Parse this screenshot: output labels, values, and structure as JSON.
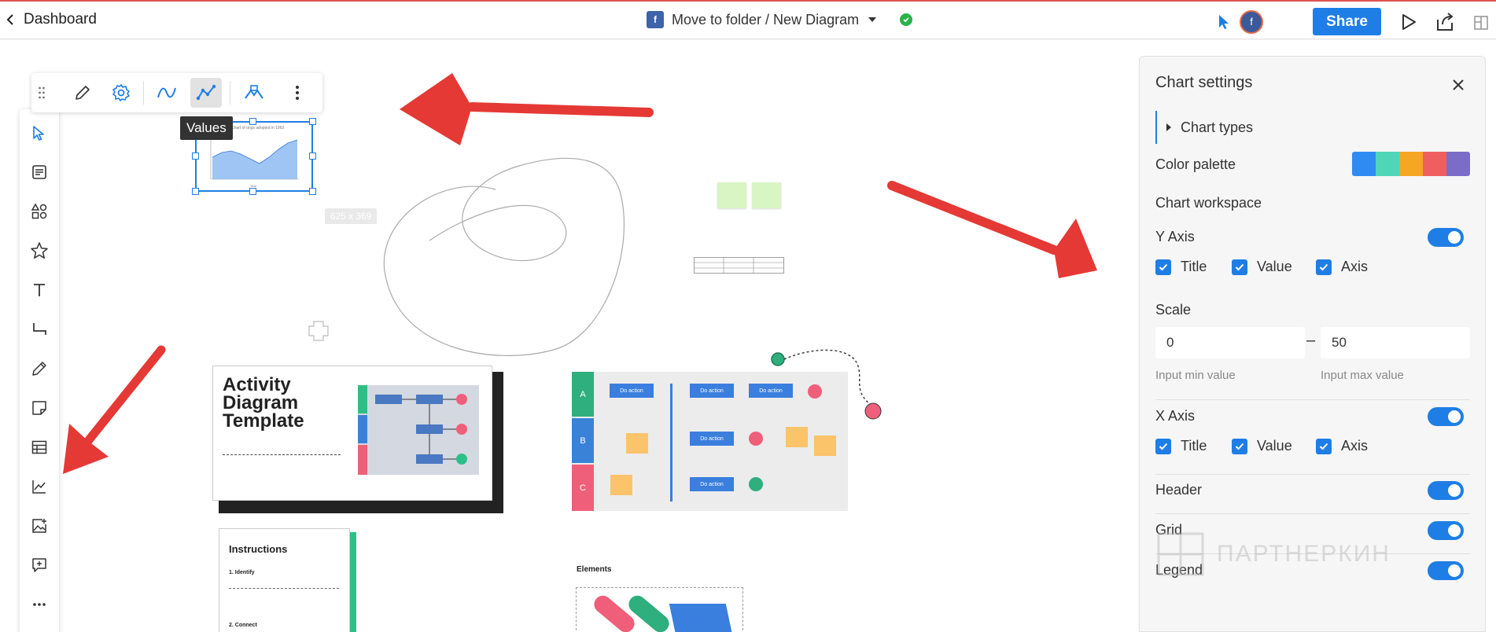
{
  "topbar": {
    "back_label": "Dashboard",
    "folder_badge": "f",
    "doc_title": "Move to folder / New Diagram",
    "avatar_initial": "f",
    "share_label": "Share"
  },
  "chart_toolbar": {
    "tooltip": "Values"
  },
  "canvas": {
    "size_tag": "625 x 369",
    "activity_title_1": "Activity",
    "activity_title_2": "Diagram",
    "activity_title_3": "Template",
    "instructions_title": "Instructions",
    "instructions_step1": "1. Identify",
    "instructions_step2": "2. Connect",
    "elements_title": "Elements",
    "lane_a": "A",
    "lane_b": "B",
    "lane_c": "C",
    "do_action": "Do action"
  },
  "panel": {
    "title": "Chart settings",
    "chart_types": "Chart types",
    "color_palette": "Color palette",
    "palette_colors": [
      "#2f8bf2",
      "#4fd6b6",
      "#f5a623",
      "#ef5f5f",
      "#7b6cc8"
    ],
    "chart_workspace": "Chart workspace",
    "y_axis": "Y Axis",
    "x_axis": "X Axis",
    "title_check": "Title",
    "value_check": "Value",
    "axis_check": "Axis",
    "scale": "Scale",
    "scale_min": "0",
    "scale_max": "50",
    "scale_dash": "–",
    "input_min_hint": "Input min value",
    "input_max_hint": "Input max value",
    "header": "Header",
    "grid": "Grid",
    "legend": "Legend",
    "watermark": "ПАРТНЕРКИН"
  },
  "colors": {
    "accent": "#1e7ee6",
    "arrow_red": "#e53935"
  }
}
